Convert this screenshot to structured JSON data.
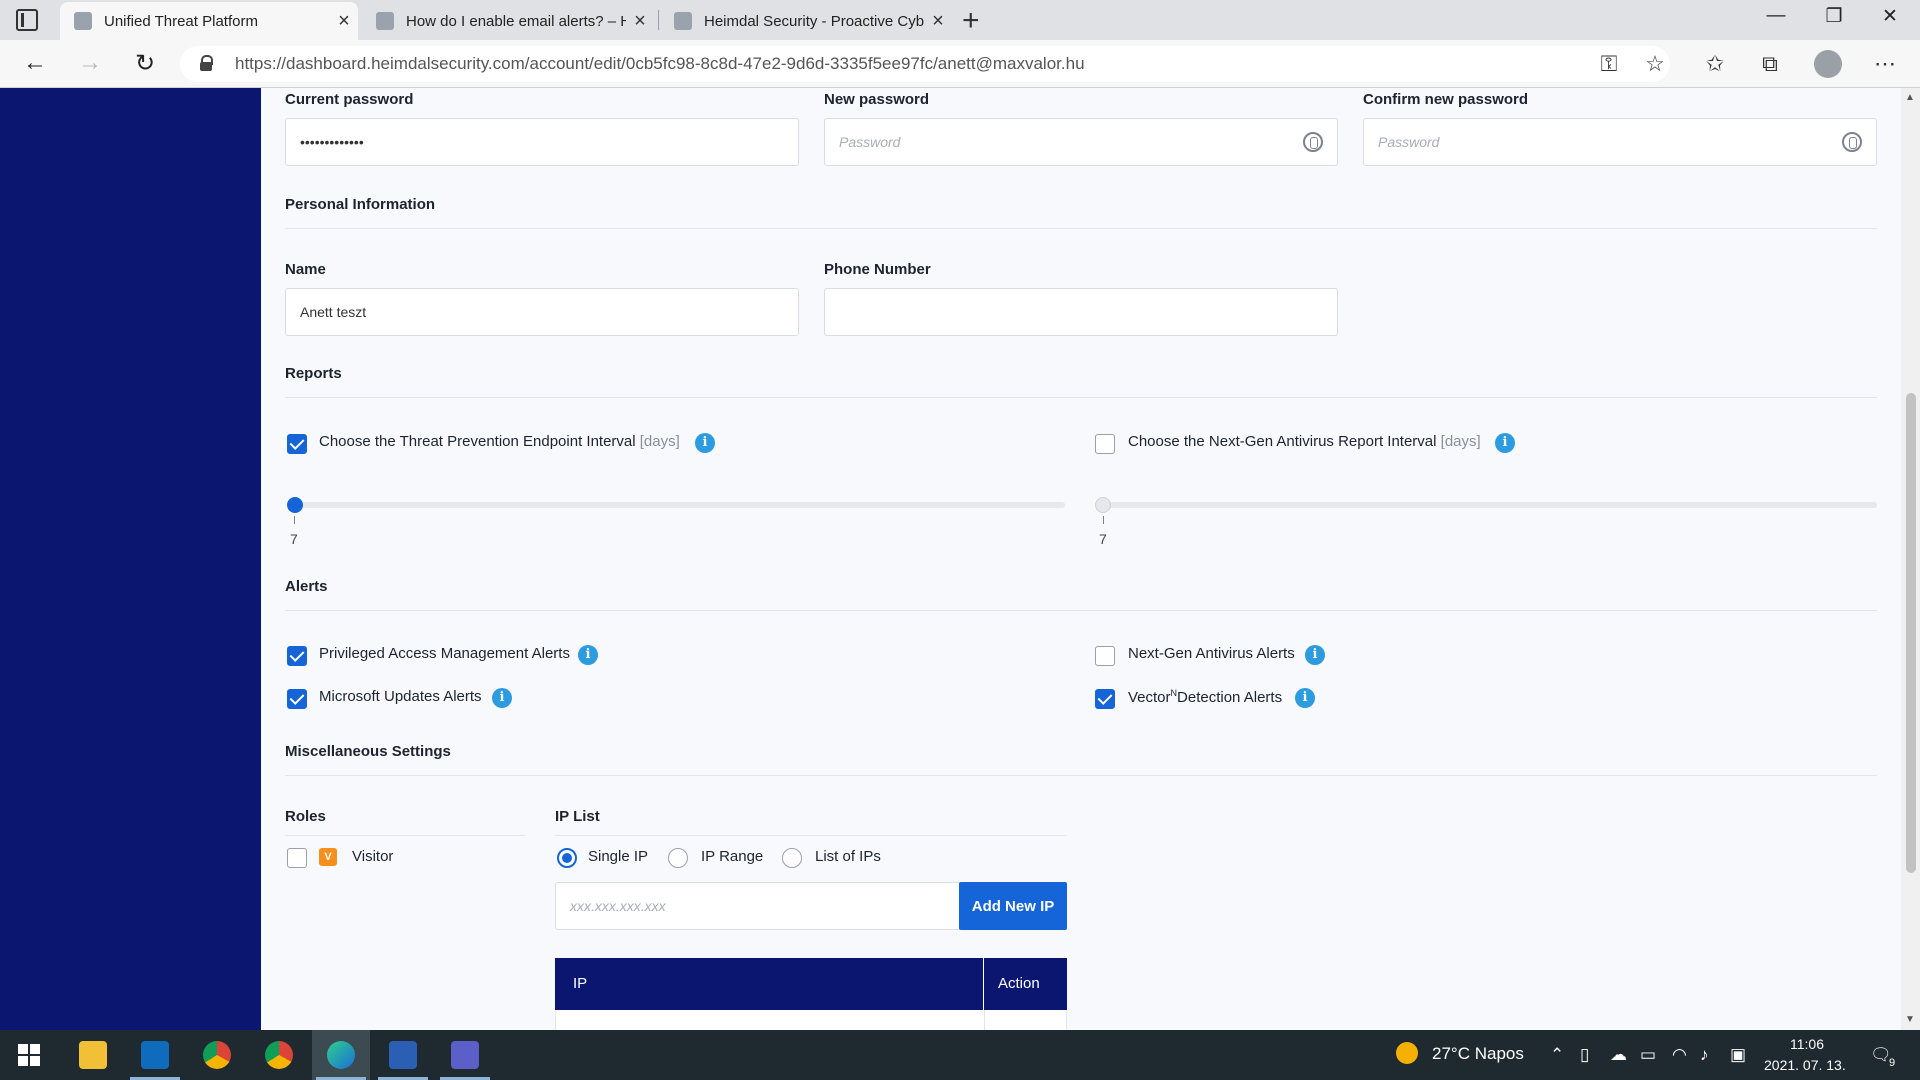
{
  "browser": {
    "tabs": [
      {
        "title": "Unified Threat Platform",
        "active": true
      },
      {
        "title": "How do I enable email alerts? – H",
        "active": false
      },
      {
        "title": "Heimdal Security - Proactive Cyb",
        "active": false
      }
    ],
    "url": "https://dashboard.heimdalsecurity.com/account/edit/0cb5fc98-8c8d-47e2-9d6d-3335f5ee97fc/anett@maxvalor.hu",
    "icons": {
      "tab_actions": "tab-actions-icon",
      "close": "×",
      "new_tab": "+",
      "back": "←",
      "forward": "→",
      "refresh": "↻",
      "key": "⚿",
      "add_favorite": "☆",
      "favorites": "✩",
      "collections": "⧉",
      "more": "⋯",
      "minimize": "—",
      "maximize": "❐",
      "close_window": "✕"
    }
  },
  "password": {
    "current_label": "Current password",
    "current_value": "•••••••••••••",
    "new_label": "New password",
    "new_placeholder": "Password",
    "confirm_label": "Confirm new password",
    "confirm_placeholder": "Password"
  },
  "personal": {
    "section_title": "Personal Information",
    "name_label": "Name",
    "name_value": "Anett teszt",
    "phone_label": "Phone Number",
    "phone_value": ""
  },
  "reports": {
    "section_title": "Reports",
    "items": [
      {
        "label": "Choose the Threat Prevention Endpoint Interval",
        "unit": "[days]",
        "checked": true,
        "value": "7"
      },
      {
        "label": "Choose the Next-Gen Antivirus Report Interval",
        "unit": "[days]",
        "checked": false,
        "value": "7"
      }
    ]
  },
  "alerts": {
    "section_title": "Alerts",
    "pam": {
      "label": "Privileged Access Management Alerts",
      "checked": true
    },
    "ms_updates": {
      "label": "Microsoft Updates Alerts",
      "checked": true
    },
    "ngav": {
      "label": "Next-Gen Antivirus Alerts",
      "checked": false
    },
    "vector": {
      "label_a": "Vector",
      "label_sup": "N",
      "label_b": "Detection Alerts",
      "checked": true
    }
  },
  "misc": {
    "section_title": "Miscellaneous Settings",
    "roles_label": "Roles",
    "role": {
      "badge": "V",
      "label": "Visitor",
      "checked": false
    },
    "ip_label": "IP List",
    "ip_modes": [
      {
        "label": "Single IP",
        "selected": true
      },
      {
        "label": "IP Range",
        "selected": false
      },
      {
        "label": "List of IPs",
        "selected": false
      }
    ],
    "ip_placeholder": "xxx.xxx.xxx.xxx",
    "add_button": "Add New IP",
    "table_headers": [
      "IP",
      "Action"
    ]
  },
  "info_glyph": "i",
  "colors": {
    "sidebar": "#0a1670",
    "accent": "#1565d8",
    "info": "#2c9be0",
    "role_badge": "#f5901e"
  },
  "taskbar": {
    "apps": [
      "windows-start-icon",
      "file-explorer-icon",
      "outlook-icon",
      "chrome-icon",
      "chrome-icon",
      "edge-icon",
      "word-icon",
      "teams-icon"
    ],
    "weather": "27°C  Napos",
    "time": "11:06",
    "date": "2021. 07. 13.",
    "notifications": "9"
  }
}
